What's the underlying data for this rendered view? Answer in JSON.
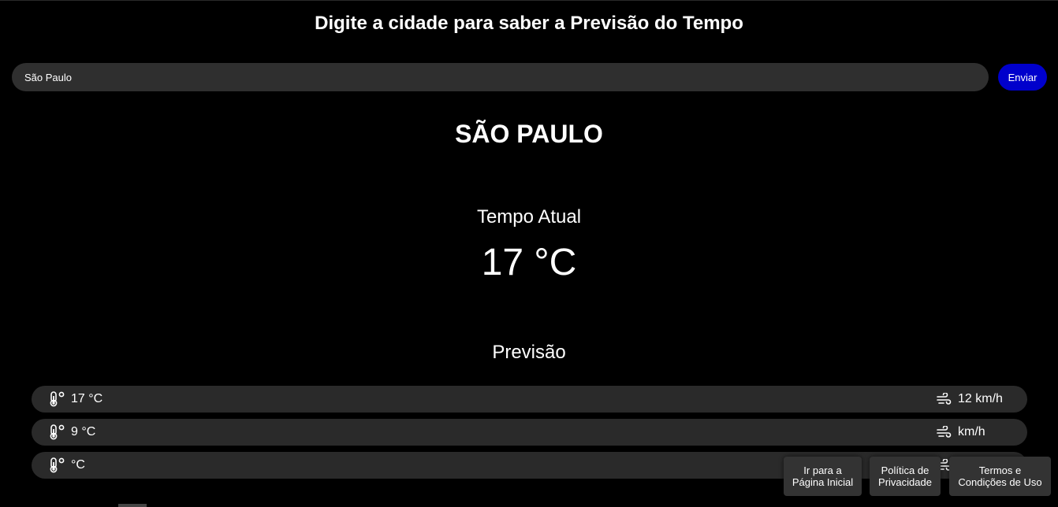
{
  "header": {
    "title": "Digite a cidade para saber a Previsão do Tempo"
  },
  "search": {
    "value": "São Paulo",
    "button_label": "Enviar"
  },
  "city": {
    "name": "SÃO PAULO"
  },
  "current": {
    "heading": "Tempo Atual",
    "temperature": "17 °C"
  },
  "forecast": {
    "heading": "Previsão",
    "rows": [
      {
        "temp": "17 °C",
        "wind": "12 km/h"
      },
      {
        "temp": "9 °C",
        "wind": "km/h"
      },
      {
        "temp": "°C",
        "wind": ""
      }
    ]
  },
  "footer": {
    "home_line1": "Ir para a",
    "home_line2": "Página Inicial",
    "privacy_line1": "Política de",
    "privacy_line2": "Privacidade",
    "terms_line1": "Termos e",
    "terms_line2": "Condições de Uso"
  },
  "icons": {
    "temperature": "thermometer-icon",
    "wind": "wind-icon"
  },
  "colors": {
    "background": "#000000",
    "accent": "#0000cc",
    "surface": "#2a2a2a"
  }
}
